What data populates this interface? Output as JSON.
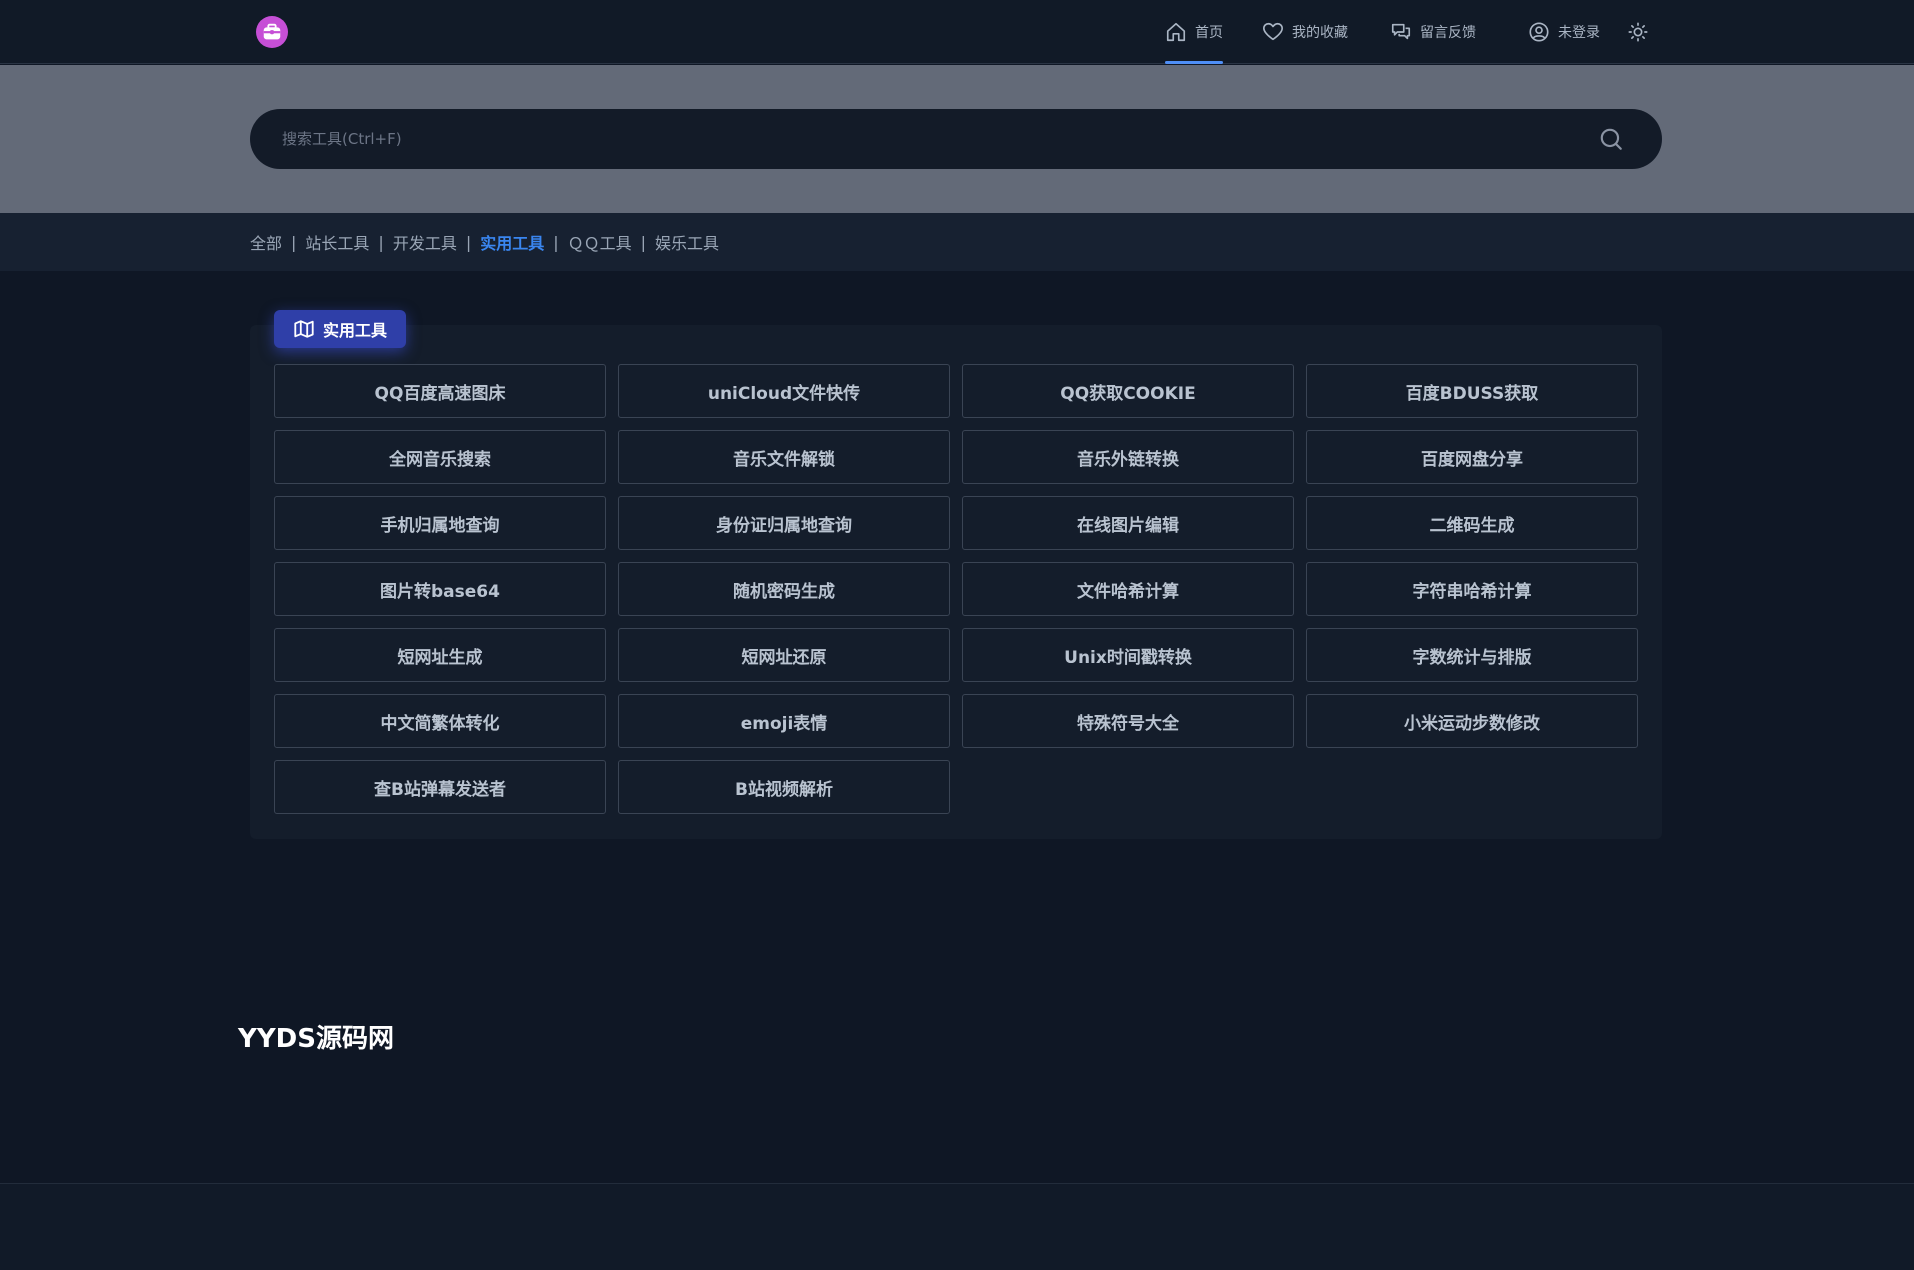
{
  "header": {
    "logo_icon": "toolbox-icon",
    "nav": [
      {
        "label": "首页",
        "icon": "home-icon",
        "active": true
      },
      {
        "label": "我的收藏",
        "icon": "heart-icon",
        "active": false
      },
      {
        "label": "留言反馈",
        "icon": "chat-icon",
        "active": false
      },
      {
        "label": "未登录",
        "icon": "user-icon",
        "active": false
      }
    ],
    "theme_icon": "sun-icon"
  },
  "search": {
    "placeholder": "搜索工具(Ctrl+F)",
    "value": "",
    "icon": "search-icon"
  },
  "categories": [
    {
      "label": "全部",
      "active": false
    },
    {
      "label": "站长工具",
      "active": false
    },
    {
      "label": "开发工具",
      "active": false
    },
    {
      "label": "实用工具",
      "active": true
    },
    {
      "label": "ＱＱ工具",
      "active": false
    },
    {
      "label": "娱乐工具",
      "active": false
    }
  ],
  "section": {
    "title": "实用工具",
    "icon": "map-icon",
    "tools": [
      "QQ百度高速图床",
      "uniCloud文件快传",
      "QQ获取COOKIE",
      "百度BDUSS获取",
      "全网音乐搜索",
      "音乐文件解锁",
      "音乐外链转换",
      "百度网盘分享",
      "手机归属地查询",
      "身份证归属地查询",
      "在线图片编辑",
      "二维码生成",
      "图片转base64",
      "随机密码生成",
      "文件哈希计算",
      "字符串哈希计算",
      "短网址生成",
      "短网址还原",
      "Unix时间戳转换",
      "字数统计与排版",
      "中文简繁体转化",
      "emoji表情",
      "特殊符号大全",
      "小米运动步数修改",
      "查B站弹幕发送者",
      "B站视频解析"
    ]
  },
  "footer": {
    "site_name": "YYDS源码网"
  },
  "colors": {
    "accent": "#3a86f0",
    "badge": "#2f3fa8",
    "logo": "#c64fd6",
    "page_bg": "#0f1725"
  }
}
